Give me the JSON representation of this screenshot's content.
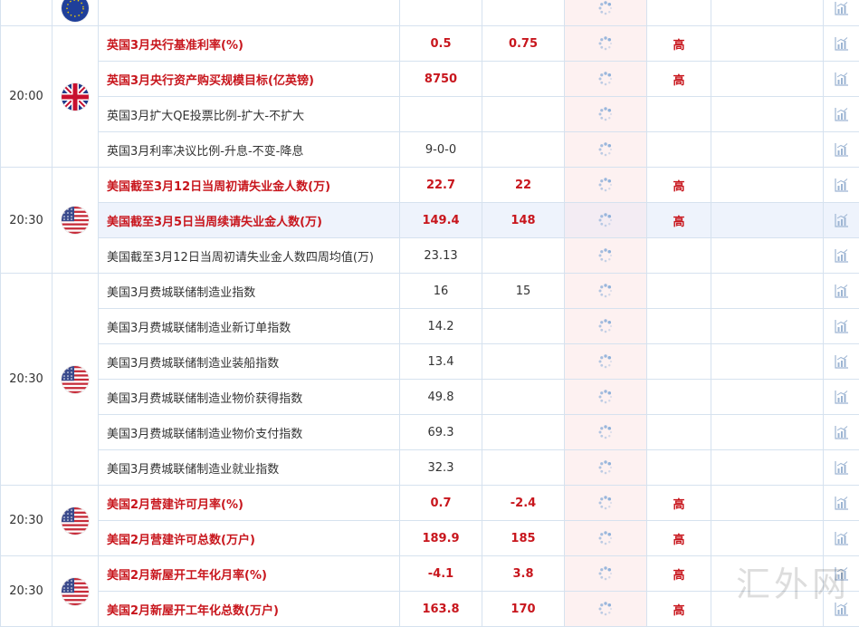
{
  "colors": {
    "important_text": "#c8161d",
    "normal_text": "#333333",
    "border": "#d6e2ef",
    "forecast_bg": "#fdf1f1",
    "highlight_row_bg": "#eef3fc",
    "icon": "#9db5d3"
  },
  "groups": [
    {
      "time": "",
      "flag": "eu-flag-icon",
      "rows": [
        {
          "event": "",
          "actual": "",
          "previous": "",
          "importance": "",
          "important": false
        }
      ]
    },
    {
      "time": "20:00",
      "flag": "uk-flag-icon",
      "rows": [
        {
          "event": "英国3月央行基准利率(%)",
          "actual": "0.5",
          "previous": "0.75",
          "importance": "高",
          "important": true
        },
        {
          "event": "英国3月央行资产购买规模目标(亿英镑)",
          "actual": "8750",
          "previous": "",
          "importance": "高",
          "important": true
        },
        {
          "event": "英国3月扩大QE投票比例-扩大-不扩大",
          "actual": "",
          "previous": "",
          "importance": "",
          "important": false
        },
        {
          "event": "英国3月利率决议比例-升息-不变-降息",
          "actual": "9-0-0",
          "previous": "",
          "importance": "",
          "important": false
        }
      ]
    },
    {
      "time": "20:30",
      "flag": "us-flag-icon",
      "rows": [
        {
          "event": "美国截至3月12日当周初请失业金人数(万)",
          "actual": "22.7",
          "previous": "22",
          "importance": "高",
          "important": true
        },
        {
          "event": "美国截至3月5日当周续请失业金人数(万)",
          "actual": "149.4",
          "previous": "148",
          "importance": "高",
          "important": true,
          "highlight": true
        },
        {
          "event": "美国截至3月12日当周初请失业金人数四周均值(万)",
          "actual": "23.13",
          "previous": "",
          "importance": "",
          "important": false
        }
      ]
    },
    {
      "time": "20:30",
      "flag": "us-flag-icon",
      "rows": [
        {
          "event": "美国3月费城联储制造业指数",
          "actual": "16",
          "previous": "15",
          "importance": "",
          "important": false
        },
        {
          "event": "美国3月费城联储制造业新订单指数",
          "actual": "14.2",
          "previous": "",
          "importance": "",
          "important": false
        },
        {
          "event": "美国3月费城联储制造业装船指数",
          "actual": "13.4",
          "previous": "",
          "importance": "",
          "important": false
        },
        {
          "event": "美国3月费城联储制造业物价获得指数",
          "actual": "49.8",
          "previous": "",
          "importance": "",
          "important": false
        },
        {
          "event": "美国3月费城联储制造业物价支付指数",
          "actual": "69.3",
          "previous": "",
          "importance": "",
          "important": false
        },
        {
          "event": "美国3月费城联储制造业就业指数",
          "actual": "32.3",
          "previous": "",
          "importance": "",
          "important": false
        }
      ]
    },
    {
      "time": "20:30",
      "flag": "us-flag-icon",
      "rows": [
        {
          "event": "美国2月营建许可月率(%)",
          "actual": "0.7",
          "previous": "-2.4",
          "importance": "高",
          "important": true
        },
        {
          "event": "美国2月营建许可总数(万户)",
          "actual": "189.9",
          "previous": "185",
          "importance": "高",
          "important": true
        }
      ]
    },
    {
      "time": "20:30",
      "flag": "us-flag-icon",
      "rows": [
        {
          "event": "美国2月新屋开工年化月率(%)",
          "actual": "-4.1",
          "previous": "3.8",
          "importance": "高",
          "important": true
        },
        {
          "event": "美国2月新屋开工年化总数(万户)",
          "actual": "163.8",
          "previous": "170",
          "importance": "高",
          "important": true
        }
      ]
    }
  ],
  "watermark": "汇外网"
}
